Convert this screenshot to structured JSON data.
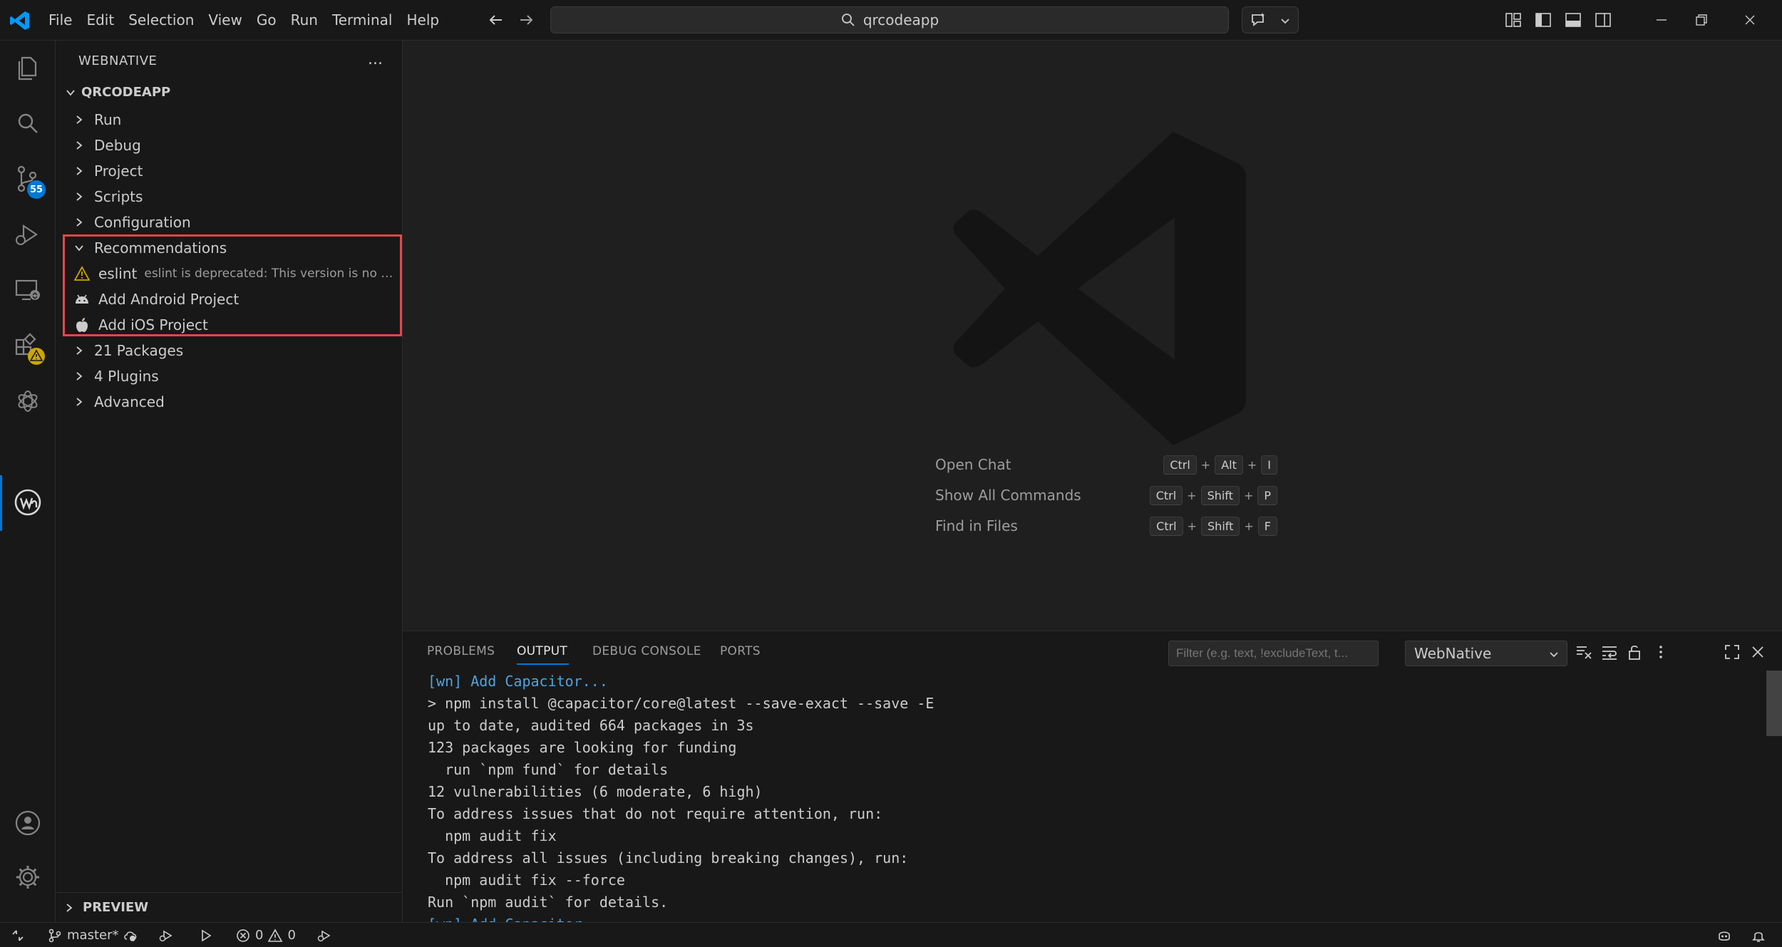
{
  "titlebar": {
    "menu": [
      "File",
      "Edit",
      "Selection",
      "View",
      "Go",
      "Run",
      "Terminal",
      "Help"
    ],
    "search_text": "qrcodeapp"
  },
  "activity": {
    "scm_badge": "55",
    "extensions_badge": "warning-icon"
  },
  "sidebar": {
    "header": "WEBNATIVE",
    "more": "...",
    "root": "QRCODEAPP",
    "items": [
      {
        "label": "Run"
      },
      {
        "label": "Debug"
      },
      {
        "label": "Project"
      },
      {
        "label": "Scripts"
      },
      {
        "label": "Configuration"
      }
    ],
    "recommendations": {
      "label": "Recommendations",
      "eslint_name": "eslint",
      "eslint_desc": "eslint is deprecated: This version is no l...",
      "android": "Add Android Project",
      "ios": "Add iOS Project"
    },
    "after_items": [
      {
        "label": "21 Packages"
      },
      {
        "label": "4 Plugins"
      },
      {
        "label": "Advanced"
      }
    ],
    "preview": "PREVIEW"
  },
  "editor": {
    "shortcuts": [
      {
        "label": "Open Chat",
        "keys": [
          "Ctrl",
          "Alt",
          "I"
        ]
      },
      {
        "label": "Show All Commands",
        "keys": [
          "Ctrl",
          "Shift",
          "P"
        ]
      },
      {
        "label": "Find in Files",
        "keys": [
          "Ctrl",
          "Shift",
          "F"
        ]
      }
    ],
    "plus": "+"
  },
  "panel": {
    "tabs": [
      "PROBLEMS",
      "OUTPUT",
      "DEBUG CONSOLE",
      "PORTS"
    ],
    "active_tab": "OUTPUT",
    "filter_placeholder": "Filter (e.g. text, !excludeText, t...",
    "channel": "WebNative",
    "output_lines": [
      "[wn] Add Capacitor...",
      "> npm install @capacitor/core@latest --save-exact --save -E",
      "up to date, audited 664 packages in 3s",
      "123 packages are looking for funding",
      "  run `npm fund` for details",
      "12 vulnerabilities (6 moderate, 6 high)",
      "To address issues that do not require attention, run:",
      "  npm audit fix",
      "To address all issues (including breaking changes), run:",
      "  npm audit fix --force",
      "Run `npm audit` for details.",
      "[wn] Add Capacitor..."
    ]
  },
  "statusbar": {
    "branch": "master*",
    "errors": "0",
    "warnings": "0"
  },
  "colors": {
    "accent": "#0078d4",
    "highlight": "#e5474b",
    "warning": "#cca700"
  }
}
